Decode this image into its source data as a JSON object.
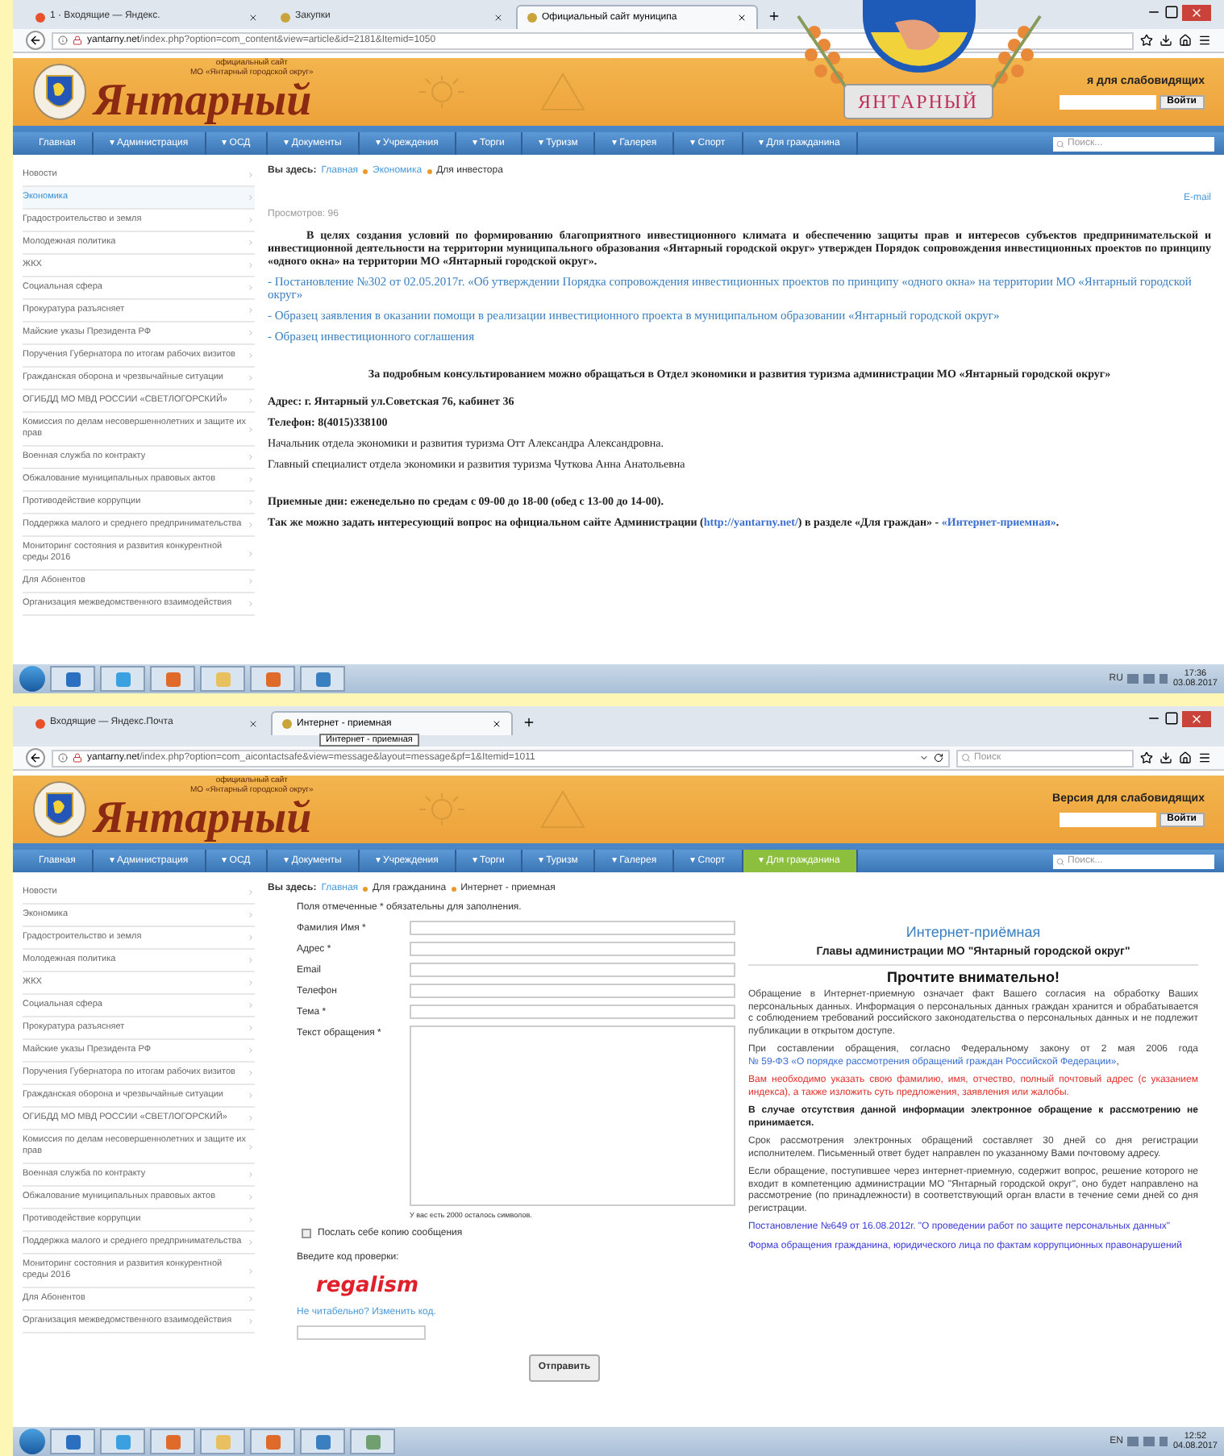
{
  "emblem": {
    "ribbon": "ЯНТАРНЫЙ"
  },
  "screens": [
    {
      "tabs": [
        {
          "label": "1 · Входящие — Яндекс.",
          "selected": false
        },
        {
          "label": "Закупки",
          "selected": false
        },
        {
          "label": "Официальный сайт муниципа",
          "selected": true
        }
      ],
      "url_host": "yantarny.net",
      "url_path": "/index.php?option=com_content&view=article&id=2181&Itemid=1050",
      "banner": {
        "subtitle": [
          "официальный сайт",
          "МО «Янтарный городской округ»"
        ],
        "title": "Янтарный",
        "accessibility": "я для слабовидящих",
        "login": "Войти"
      },
      "nav": [
        {
          "label": "Главная",
          "selected": false
        },
        {
          "label": "▾ Администрация",
          "selected": false
        },
        {
          "label": "▾ ОСД",
          "selected": false
        },
        {
          "label": "▾ Документы",
          "selected": false
        },
        {
          "label": "▾ Учреждения",
          "selected": false
        },
        {
          "label": "▾ Торги",
          "selected": false
        },
        {
          "label": "▾ Туризм",
          "selected": false
        },
        {
          "label": "▾ Галерея",
          "selected": false
        },
        {
          "label": "▾ Спорт",
          "selected": false
        },
        {
          "label": "▾ Для гражданина",
          "selected": false
        }
      ],
      "search_placeholder": "Поиск...",
      "sidebar": [
        {
          "label": "Новости",
          "selected": false
        },
        {
          "label": "Экономика",
          "selected": true
        },
        {
          "label": "Градостроительство и земля",
          "selected": false
        },
        {
          "label": "Молодежная политика",
          "selected": false
        },
        {
          "label": "ЖКХ",
          "selected": false
        },
        {
          "label": "Социальная сфера",
          "selected": false
        },
        {
          "label": "Прокуратура разъясняет",
          "selected": false
        },
        {
          "label": "Майские указы Президента РФ",
          "selected": false
        },
        {
          "label": "Поручения Губернатора по итогам рабочих визитов",
          "selected": false
        },
        {
          "label": "Гражданская оборона и чрезвычайные ситуации",
          "selected": false
        },
        {
          "label": "ОГИБДД МО МВД РОССИИ «СВЕТЛОГОРСКИЙ»",
          "selected": false
        },
        {
          "label": "Комиссия по делам несовершеннолетних и защите их прав",
          "selected": false
        },
        {
          "label": "Военная служба по контракту",
          "selected": false
        },
        {
          "label": "Обжалование муниципальных правовых актов",
          "selected": false
        },
        {
          "label": "Противодействие коррупции",
          "selected": false
        },
        {
          "label": "Поддержка малого и среднего предпринимательства",
          "selected": false
        },
        {
          "label": "Мониторинг состояния и развития конкурентной среды 2016",
          "selected": false
        },
        {
          "label": "Для Абонентов",
          "selected": false
        },
        {
          "label": "Организация межведомственного взаимодействия",
          "selected": false
        }
      ],
      "breadcrumb": {
        "prefix": "Вы здесь:",
        "items": [
          {
            "label": "Главная",
            "link": true
          },
          {
            "label": "Экономика",
            "link": true
          },
          {
            "label": "Для инвестора",
            "link": false
          }
        ]
      },
      "content": {
        "kind": "article",
        "views": "Просмотров: 96",
        "email": "E-mail",
        "intro": "В целях создания условий по формированию благоприятного инвестиционного климата и обеспечению защиты прав и интересов субъектов предпринимательской и инвестиционной деятельности на территории муниципального образования «Янтарный городской округ» утвержден Порядок сопровождения инвестиционных проектов по принципу «одного окна» на территории МО «Янтарный городской округ».",
        "links": [
          "- Постановление №302 от 02.05.2017г. «Об утверждении Порядка сопровождения инвестиционных проектов по принципу «одного окна» на территории МО «Янтарный городской округ»",
          "- Образец заявления в оказании помощи в реализации инвестиционного проекта  в  муниципальном образовании «Янтарный городской округ»",
          "- Образец  инвестиционного соглашения"
        ],
        "consult": "За подробным консультированием можно обращаться в  Отдел экономики и развития туризма  администрации МО «Янтарный городской округ»",
        "address": "Адрес: г. Янтарный  ул.Советская 76, кабинет 36",
        "phone": "Телефон: 8(4015)338100",
        "staff": [
          "Начальник отдела экономики и развития туризма Отт Александра Александровна.",
          "Главный специалист отдела экономики и развития туризма Чуткова Анна Анатольевна"
        ],
        "hours": "Приемные дни: еженедельно по средам с 09-00 до 18-00 (обед с 13-00 до 14-00).",
        "ask": [
          {
            "text": "Так же можно  задать интересующий вопрос на официальном сайте Администрации  (",
            "link": false
          },
          {
            "text": "http://yantarny.net/",
            "link": true
          },
          {
            "text": ")  в разделе «Для граждан» - ",
            "link": false
          },
          {
            "text": "«Интернет-приемная»",
            "link": true
          },
          {
            "text": ".",
            "link": false
          }
        ]
      },
      "taskbar": {
        "lang": "RU",
        "time": "17:36",
        "date": "03.08.2017"
      }
    },
    {
      "tabs": [
        {
          "label": "Входящие — Яндекс.Почта",
          "selected": false
        },
        {
          "label": "Интернет - приемная",
          "selected": true
        }
      ],
      "tooltip": "Интернет - приемная",
      "url_host": "yantarny.net",
      "url_path": "/index.php?option=com_aicontactsafe&view=message&layout=message&pf=1&Itemid=1011",
      "browser_search": "Поиск",
      "banner": {
        "subtitle": [
          "официальный сайт",
          "МО «Янтарный городской округ»"
        ],
        "title": "Янтарный",
        "accessibility": "Версия для слабовидящих",
        "login": "Войти"
      },
      "nav": [
        {
          "label": "Главная",
          "selected": false
        },
        {
          "label": "▾ Администрация",
          "selected": false
        },
        {
          "label": "▾ ОСД",
          "selected": false
        },
        {
          "label": "▾ Документы",
          "selected": false
        },
        {
          "label": "▾ Учреждения",
          "selected": false
        },
        {
          "label": "▾ Торги",
          "selected": false
        },
        {
          "label": "▾ Туризм",
          "selected": false
        },
        {
          "label": "▾ Галерея",
          "selected": false
        },
        {
          "label": "▾ Спорт",
          "selected": false
        },
        {
          "label": "▾ Для гражданина",
          "selected": true
        }
      ],
      "search_placeholder": "Поиск...",
      "sidebar": [
        {
          "label": "Новости",
          "selected": false
        },
        {
          "label": "Экономика",
          "selected": false
        },
        {
          "label": "Градостроительство и земля",
          "selected": false
        },
        {
          "label": "Молодежная политика",
          "selected": false
        },
        {
          "label": "ЖКХ",
          "selected": false
        },
        {
          "label": "Социальная сфера",
          "selected": false
        },
        {
          "label": "Прокуратура разъясняет",
          "selected": false
        },
        {
          "label": "Майские указы Президента РФ",
          "selected": false
        },
        {
          "label": "Поручения Губернатора по итогам рабочих визитов",
          "selected": false
        },
        {
          "label": "Гражданская оборона и чрезвычайные ситуации",
          "selected": false
        },
        {
          "label": "ОГИБДД МО МВД РОССИИ «СВЕТЛОГОРСКИЙ»",
          "selected": false
        },
        {
          "label": "Комиссия по делам несовершеннолетних и защите их прав",
          "selected": false
        },
        {
          "label": "Военная служба по контракту",
          "selected": false
        },
        {
          "label": "Обжалование муниципальных правовых актов",
          "selected": false
        },
        {
          "label": "Противодействие коррупции",
          "selected": false
        },
        {
          "label": "Поддержка малого и среднего предпринимательства",
          "selected": false
        },
        {
          "label": "Мониторинг состояния и развития конкурентной среды 2016",
          "selected": false
        },
        {
          "label": "Для Абонентов",
          "selected": false
        },
        {
          "label": "Организация межведомственного взаимодействия",
          "selected": false
        }
      ],
      "breadcrumb": {
        "prefix": "Вы здесь:",
        "items": [
          {
            "label": "Главная",
            "link": true
          },
          {
            "label": "Для гражданина",
            "link": false
          },
          {
            "label": "Интернет - приемная",
            "link": false
          }
        ]
      },
      "content": {
        "kind": "form",
        "note": "Поля отмеченные * обязательны для заполнения.",
        "fields": [
          {
            "label": "Фамилия Имя  *",
            "kind": "input"
          },
          {
            "label": "Адрес  *",
            "kind": "input"
          },
          {
            "label": "Email",
            "kind": "input"
          },
          {
            "label": "Телефон",
            "kind": "input"
          },
          {
            "label": "Тема  *",
            "kind": "input"
          },
          {
            "label": "Текст обращения  *",
            "kind": "textarea"
          }
        ],
        "counter": "У вас есть  2000  осталось символов.",
        "copy": {
          "label": "Послать себе копию сообщения",
          "checked": false
        },
        "captcha_label": "Введите код проверки:",
        "captcha": "regalism",
        "captcha_link": "Не читабельно? Изменить код.",
        "submit": "Отправить",
        "panel": {
          "title": "Интернет-приёмная",
          "subtitle": "Главы администрации МО \"Янтарный городской округ\"",
          "heading": "Прочтите внимательно!",
          "paragraphs": [
            {
              "kind": "text",
              "text": "Обращение в Интернет-приемную означает факт Вашего согласия на обработку Ваших персональных данных. Информация о персональных данных граждан хранится и обрабатывается с соблюдением требований российского законодательства о персональных данных и не подлежит публикации в открытом доступе."
            },
            {
              "kind": "mixed",
              "parts": [
                {
                  "text": "При составлении обращения, согласно Федеральному закону от 2 мая 2006 года ",
                  "link": false
                },
                {
                  "text": "№ 59-ФЗ «О порядке рассмотрения обращений граждан Российской Федерации»",
                  "link": true
                },
                {
                  "text": ",",
                  "link": false
                }
              ]
            },
            {
              "kind": "red",
              "text": "Вам необходимо указать свою фамилию, имя, отчество, полный почтовый адрес (с указанием индекса), а также изложить суть предложения, заявления или жалобы."
            },
            {
              "kind": "bold",
              "text": "В случае отсутствия данной информации электронное обращение к рассмотрению не принимается."
            },
            {
              "kind": "text",
              "text": "Срок рассмотрения электронных обращений составляет 30 дней со дня регистрации исполнителем. Письменный ответ будет направлен по указанному Вами почтовому адресу."
            },
            {
              "kind": "text",
              "text": "Если обращение, поступившее через интернет-приемную, содержит вопрос, решение которого не входит в компетенцию администрации МО \"Янтарный городской округ\", оно будет направлено на рассмотрение (по принадлежности) в соответствующий орган власти в течение семи дней со дня регистрации."
            },
            {
              "kind": "link",
              "text": "Постановление №649 от 16.08.2012г. \"О проведении работ по защите персональных данных\""
            },
            {
              "kind": "link",
              "text": "Форма обращения гражданина, юридического лица по фактам коррупционных правонарушений"
            }
          ]
        }
      },
      "taskbar": {
        "lang": "EN",
        "time": "12:52",
        "date": "04.08.2017"
      }
    }
  ]
}
